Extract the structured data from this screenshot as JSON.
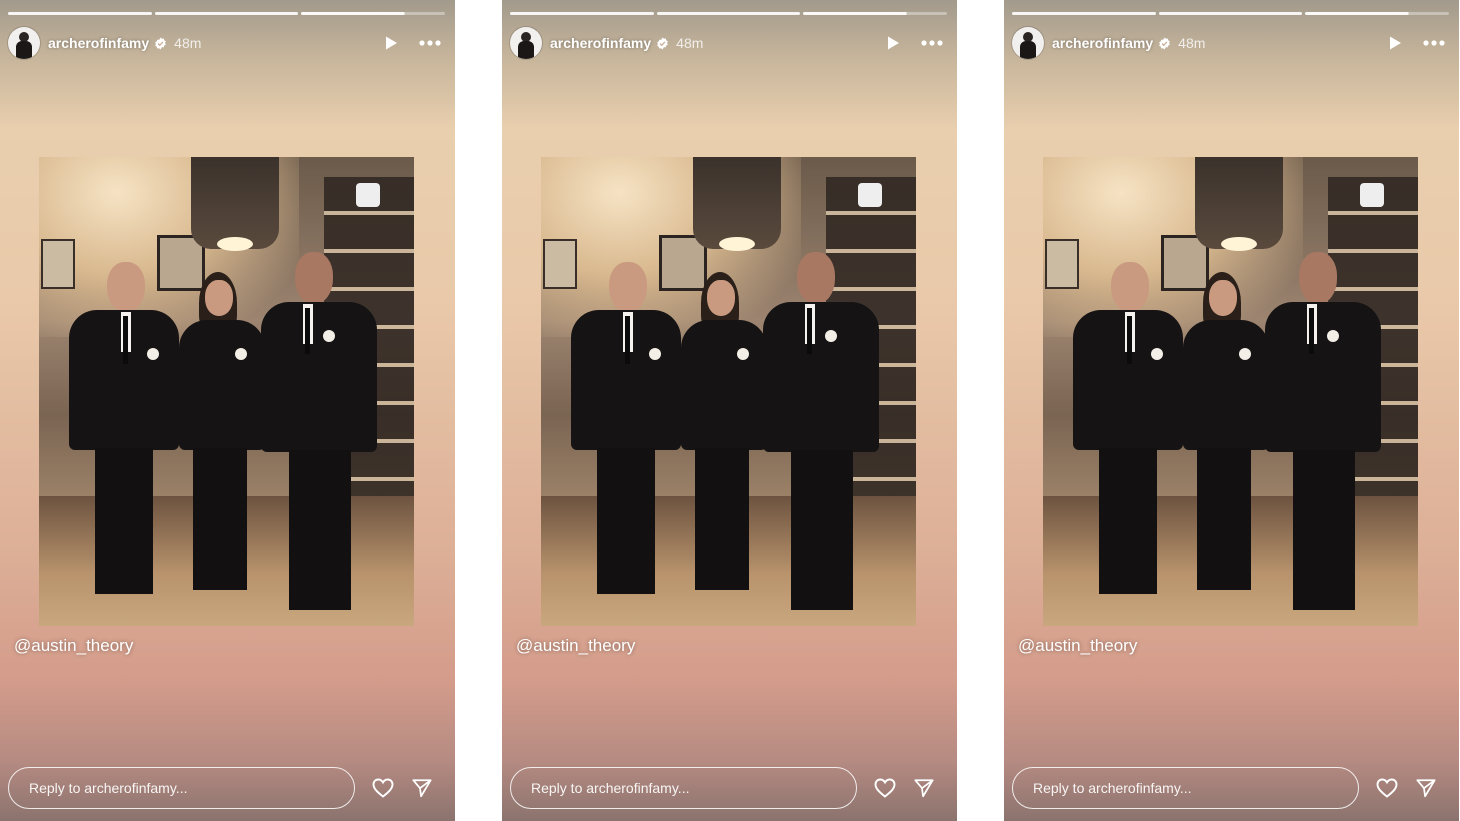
{
  "stories": [
    {
      "user": {
        "username": "archerofinfamy",
        "verified": true,
        "time": "48m"
      },
      "mention": "@austin_theory",
      "reply": {
        "placeholder": "Reply to archerofinfamy..."
      },
      "progress": [
        1,
        1,
        0.72
      ]
    },
    {
      "user": {
        "username": "archerofinfamy",
        "verified": true,
        "time": "48m"
      },
      "mention": "@austin_theory",
      "reply": {
        "placeholder": "Reply to archerofinfamy..."
      },
      "progress": [
        1,
        1,
        0.72
      ]
    },
    {
      "user": {
        "username": "archerofinfamy",
        "verified": true,
        "time": "48m"
      },
      "mention": "@austin_theory",
      "reply": {
        "placeholder": "Reply to archerofinfamy..."
      },
      "progress": [
        1,
        1,
        0.72
      ]
    }
  ],
  "icons": {
    "verified": "verified-badge-icon",
    "play": "play-icon",
    "more": "more-options-icon",
    "heart": "heart-icon",
    "send": "send-icon"
  },
  "colors": {
    "text": "#ffffff",
    "verified_badge": "#ffffff"
  }
}
